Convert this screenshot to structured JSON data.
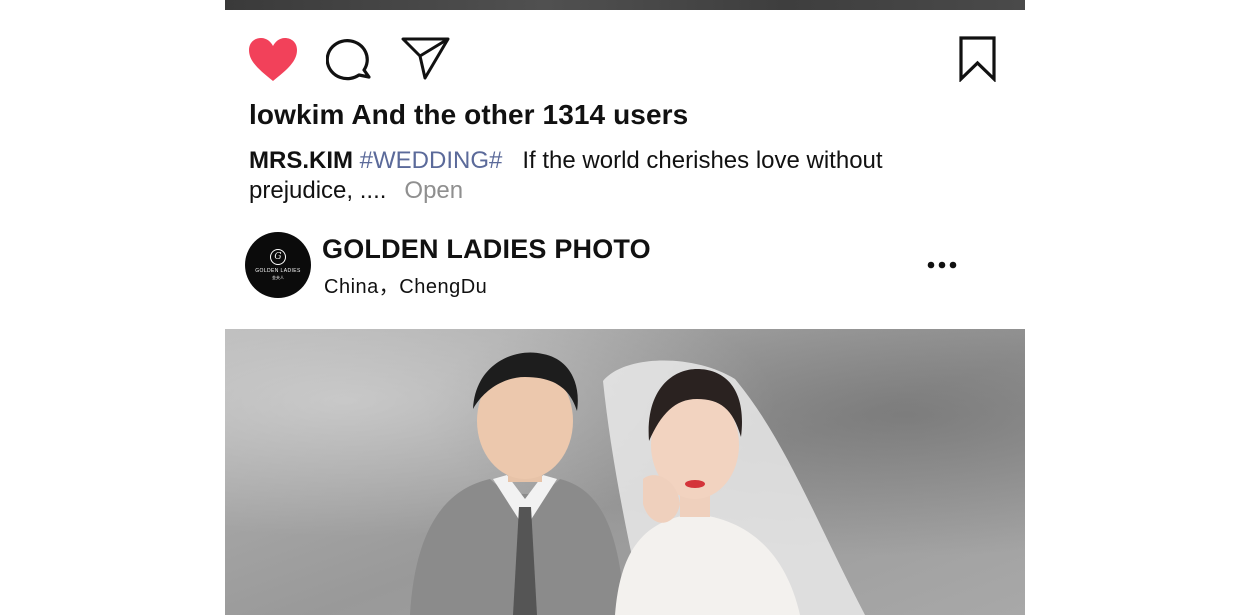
{
  "post": {
    "likes_text": "lowkim And the other 1314 users",
    "caption": {
      "author": "MRS.KIM",
      "hashtag": "#WEDDING#",
      "text": "If the world cherishes love without prejudice, ....",
      "more_label": "Open"
    }
  },
  "actions": {
    "like_icon": "heart-icon",
    "comment_icon": "comment-bubble-icon",
    "share_icon": "send-icon",
    "save_icon": "bookmark-icon",
    "liked": true,
    "like_color": "#f2415a"
  },
  "account": {
    "name": "GOLDEN LADIES PHOTO",
    "location": "China，ChengDu",
    "avatar": {
      "monogram": "G",
      "brand": "GOLDEN LADIES",
      "subtitle": "金夫人"
    },
    "menu_icon": "more-horizontal-icon"
  },
  "colors": {
    "hashtag": "#5b6a9a",
    "muted": "#8f8f8f",
    "text": "#111111"
  }
}
